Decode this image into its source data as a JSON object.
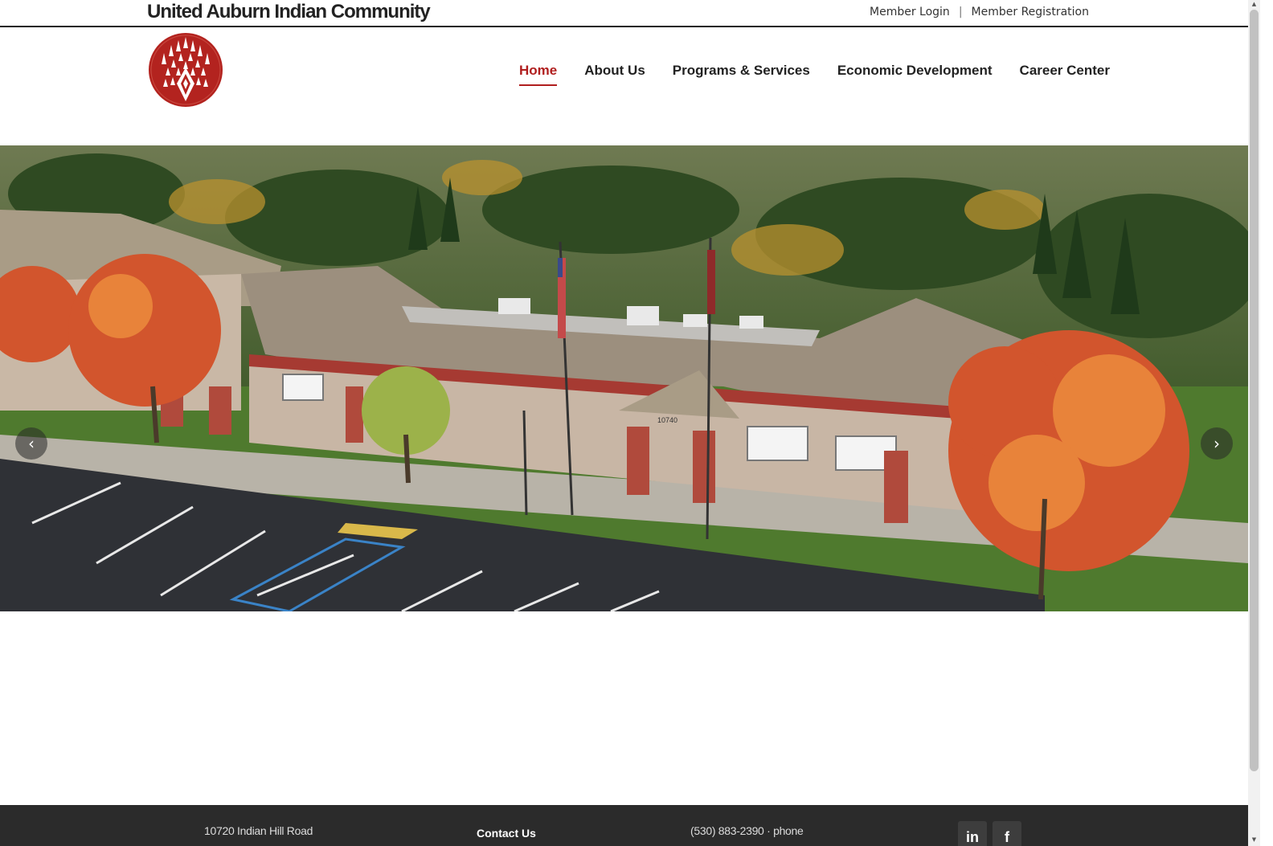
{
  "header": {
    "site_title": "United Auburn Indian Community",
    "member_login": "Member Login",
    "separator": "|",
    "member_registration": "Member Registration"
  },
  "nav": {
    "items": [
      {
        "label": "Home",
        "active": true
      },
      {
        "label": "About Us",
        "active": false
      },
      {
        "label": "Programs & Services",
        "active": false
      },
      {
        "label": "Economic Development",
        "active": false
      },
      {
        "label": "Career Center",
        "active": false
      }
    ]
  },
  "hero": {
    "prev_arrow": "‹",
    "next_arrow": "›",
    "building_number": "10740"
  },
  "footer": {
    "address": "10720 Indian Hill Road",
    "contact_heading": "Contact Us",
    "phone": "(530) 883-2390 · phone",
    "social": [
      {
        "name": "linkedin-icon",
        "glyph": "in"
      },
      {
        "name": "facebook-icon",
        "glyph": "f"
      }
    ]
  },
  "colors": {
    "accent": "#b01e1e",
    "footer_bg": "#2b2b2b",
    "logo_red": "#b3231f"
  }
}
